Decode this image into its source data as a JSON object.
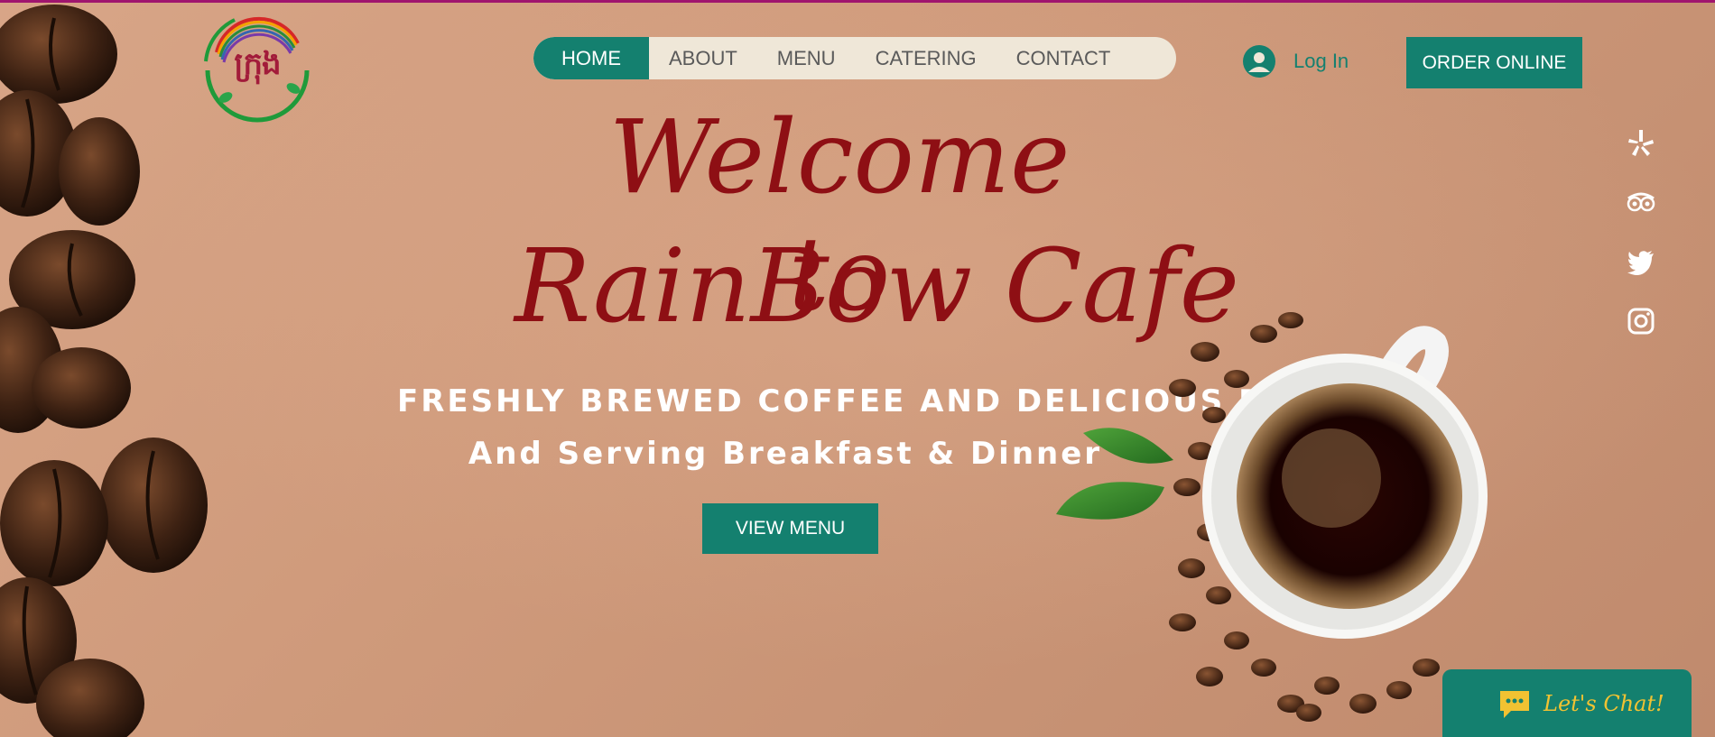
{
  "colors": {
    "accent": "#14806f",
    "headline": "#8e0f14",
    "nav_bg": "#efe7d8",
    "top_bar": "#a0156e",
    "chat_text": "#f1c232"
  },
  "logo": {
    "text": "ក្រុង",
    "icon": "rainbow-logo"
  },
  "nav": {
    "items": [
      {
        "label": "HOME",
        "active": true
      },
      {
        "label": "ABOUT",
        "active": false
      },
      {
        "label": "MENU",
        "active": false
      },
      {
        "label": "CATERING",
        "active": false
      },
      {
        "label": "CONTACT",
        "active": false
      }
    ]
  },
  "login": {
    "label": "Log In",
    "icon": "user-avatar-icon"
  },
  "order": {
    "label": "ORDER ONLINE"
  },
  "social": [
    {
      "icon": "yelp-icon"
    },
    {
      "icon": "tripadvisor-icon"
    },
    {
      "icon": "twitter-icon"
    },
    {
      "icon": "instagram-icon"
    }
  ],
  "hero": {
    "welcome": "Welcome to",
    "brand": "RainBow Cafe",
    "tagline": "FRESHLY BREWED COFFEE AND DELICIOUS PASTRIES",
    "subtagline": "And Serving Breakfast & Dinner",
    "cta": "VIEW MENU"
  },
  "chat": {
    "label": "Let's Chat!",
    "icon": "chat-bubble-icon"
  }
}
